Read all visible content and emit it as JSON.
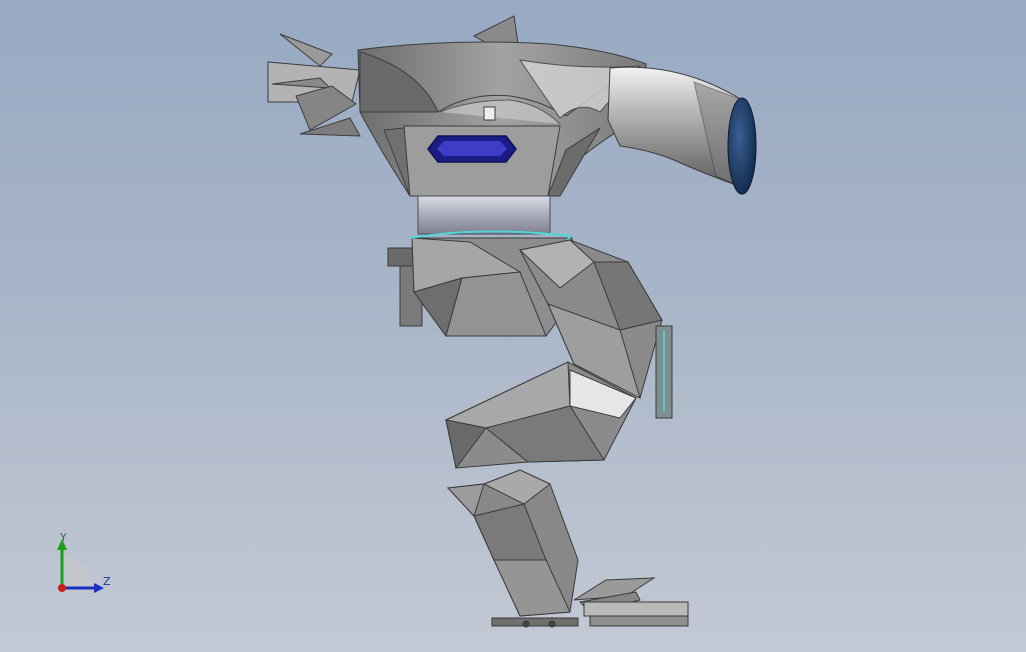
{
  "viewport": {
    "background_top": "#97a9c3",
    "background_bottom": "#c3c9d4"
  },
  "model": {
    "name_icon": "robot-mech-model",
    "body_color": "#8f8f8f",
    "dark_shade": "#5e5e5e",
    "light_shade": "#d6d6d6",
    "visor_color": "#2a2aa8",
    "cap_color": "#17365f",
    "highlight_cyan": "#4fd6d6"
  },
  "triad": {
    "y_label": "Y",
    "z_label": "Z",
    "y_color": "#1d9f1d",
    "z_color": "#1b2fc4",
    "origin_color": "#d11b1b"
  }
}
